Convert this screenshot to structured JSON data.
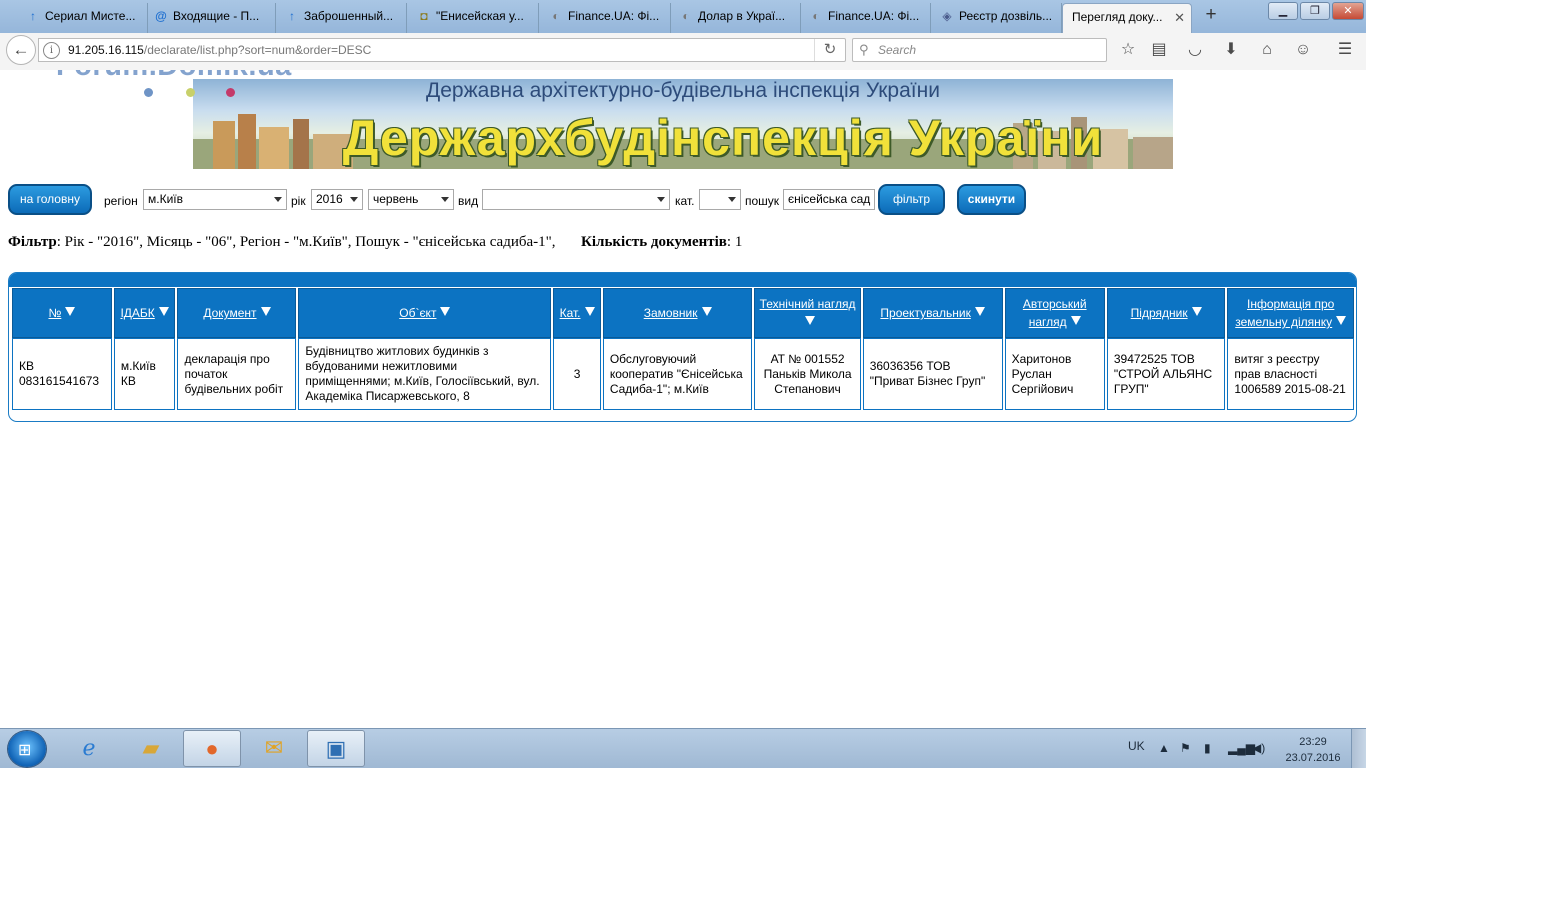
{
  "browser": {
    "tabs": [
      {
        "title": "Сериал Мисте...",
        "icon": "↑"
      },
      {
        "title": "Входящие - П...",
        "icon": "@"
      },
      {
        "title": "Заброшенный...",
        "icon": "↑"
      },
      {
        "title": "\"Енисейская у...",
        "icon": "◘"
      },
      {
        "title": "Finance.UA: Фі...",
        "icon": "◐"
      },
      {
        "title": "Долар в Украї...",
        "icon": "◐"
      },
      {
        "title": "Finance.UA: Фі...",
        "icon": "◐"
      },
      {
        "title": "Реєстр дозвіль...",
        "icon": "◈"
      },
      {
        "title": "Перегляд доку...",
        "icon": ""
      }
    ],
    "url_host": "91.205.16.115",
    "url_path": "/declarate/list.php?sort=num&order=DESC",
    "search_placeholder": "Search"
  },
  "page": {
    "watermark": "Forum.Domik.ua",
    "banner": {
      "subtitle": "Державна архітектурно-будівельна інспекція України",
      "title": "Держархбудінспекція України"
    },
    "filters": {
      "home_button": "на головну",
      "region_label": "регіон",
      "region_value": "м.Київ",
      "year_label": "рік",
      "year_value": "2016",
      "month_value": "червень",
      "type_label": "вид",
      "type_value": "",
      "cat_label": "кат.",
      "cat_value": "",
      "search_label": "пошук",
      "search_value": "єнісейська сад",
      "filter_button": "фільтр",
      "reset_button": "скинути"
    },
    "summary": {
      "filter_label": "Фільтр",
      "filter_text": ": Рік - \"2016\", Місяць - \"06\", Регіон - \"м.Київ\", Пошук - \"єнісейська садиба-1\",",
      "count_label": "Кількість документів",
      "count_value": ": 1"
    },
    "table": {
      "headers": [
        "№",
        "ІДАБК",
        "Документ",
        "Об`єкт",
        "Кат.",
        "Замовник",
        "Технічний нагляд",
        "Проектувальник",
        "Авторський нагляд",
        "Підрядник",
        "Інформація про земельну ділянку"
      ],
      "rows": [
        [
          "КВ 083161541673",
          "м.Київ КВ",
          "декларація про початок будівельних робіт",
          "Будівництво житлових будинків з вбудованими нежитловими приміщеннями; м.Київ, Голосіївський, вул. Академіка Писаржевського, 8",
          "3",
          "Обслуговуючий кооператив \"Єнісейська Садиба-1\"; м.Київ",
          "АТ № 001552 Паньків Микола Степанович",
          "36036356 ТОВ \"Приват Бізнес Груп\"",
          "Харитонов Руслан Сергійович",
          "39472525 ТОВ \"СТРОЙ АЛЬЯНС ГРУП\"",
          "витяг з реєстру прав власності 1006589 2015-08-21"
        ]
      ]
    }
  },
  "taskbar": {
    "language": "UK",
    "time": "23:29",
    "date": "23.07.2016"
  }
}
